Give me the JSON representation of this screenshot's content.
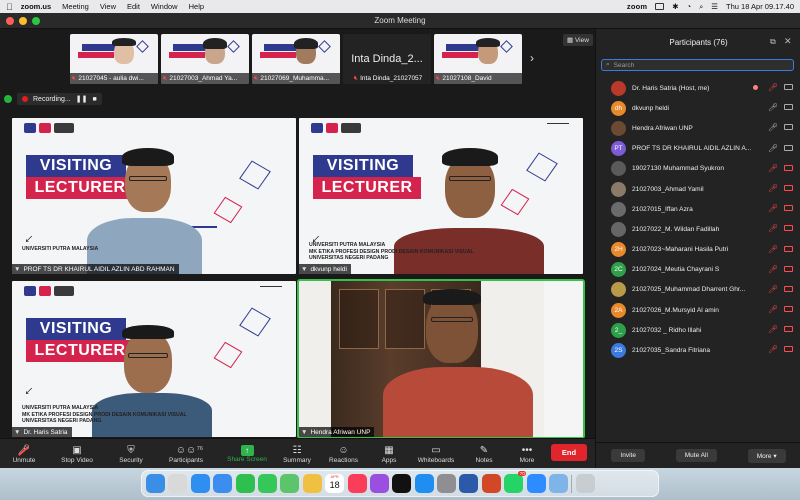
{
  "menubar": {
    "app_name": "zoom.us",
    "menus": [
      "Meeting",
      "View",
      "Edit",
      "Window",
      "Help"
    ],
    "brand": "zoom",
    "datetime": "Thu 18 Apr  09.17.40"
  },
  "window": {
    "title": "Zoom Meeting"
  },
  "strip": {
    "thumbs": [
      {
        "name": "21027045 - aulia dwi..."
      },
      {
        "name": "21027003_Ahmad Ya..."
      },
      {
        "name": "21027069_Muhamma..."
      },
      {
        "name": "Inta Dinda_21027057",
        "text": "Inta Dinda_2..."
      },
      {
        "name": "21027108_David"
      }
    ],
    "view_label": "View"
  },
  "recording": {
    "label": "Recording..."
  },
  "slides": {
    "visiting": "VISITING",
    "lecturer": "LECTURER",
    "caption1": "UNIVERSITI PUTRA MALAYSIA",
    "caption2": "MK ETIKA PROFESI DESIGN PRODI DESAIN KOMUNIKASI VISUAL",
    "caption3": "UNIVERSITAS NEGERI PADANG"
  },
  "tiles": [
    {
      "name": "PROF TS DR KHAIRUL AIDIL AZLIN ABD RAHMAN"
    },
    {
      "name": "dkvunp heldi"
    },
    {
      "name": "Dr. Haris Satria"
    },
    {
      "name": "Hendra Afriwan UNP"
    }
  ],
  "toolbar": {
    "unmute": "Unmute",
    "stop_video": "Stop Video",
    "security": "Security",
    "participants": "Participants",
    "participants_count": "76",
    "share_screen": "Share Screen",
    "summary": "Summary",
    "reactions": "Reactions",
    "apps": "Apps",
    "whiteboards": "Whiteboards",
    "notes": "Notes",
    "more": "More",
    "end": "End"
  },
  "participants": {
    "title": "Participants (76)",
    "search_placeholder": "Search",
    "list": [
      {
        "initials": "",
        "name": "Dr. Haris Satria (Host, me)",
        "color": "#b93a2a",
        "mic": "muted",
        "cam": "on",
        "rec": true
      },
      {
        "initials": "dh",
        "name": "dkvunp heldi",
        "color": "#e8892b",
        "mic": "on",
        "cam": "on"
      },
      {
        "initials": "",
        "name": "Hendra Afriwan UNP",
        "color": "#6a4a32",
        "mic": "on",
        "cam": "on"
      },
      {
        "initials": "PT",
        "name": "PROF TS DR KHAIRUL AIDIL AZLIN A...",
        "color": "#7d5bd6",
        "mic": "on",
        "cam": "on"
      },
      {
        "initials": "",
        "name": "19027130 Muhammad Syukron",
        "color": "#5a5a5a",
        "mic": "muted",
        "cam": "off"
      },
      {
        "initials": "",
        "name": "21027003_Ahmad Yamil",
        "color": "#8a7a6a",
        "mic": "muted",
        "cam": "off"
      },
      {
        "initials": "",
        "name": "21027015_Iffan Azra",
        "color": "#6b6b6b",
        "mic": "muted",
        "cam": "off"
      },
      {
        "initials": "",
        "name": "21027022_M. Wildan Fadillah",
        "color": "#666666",
        "mic": "muted",
        "cam": "off"
      },
      {
        "initials": "2H",
        "name": "21027023~Maharani Hasila Putri",
        "color": "#e8892b",
        "mic": "muted",
        "cam": "off"
      },
      {
        "initials": "2C",
        "name": "21027024_Meutia Chayrani S",
        "color": "#2fa04a",
        "mic": "muted",
        "cam": "off"
      },
      {
        "initials": "",
        "name": "21027025_Muhammad Dharrent Ghr...",
        "color": "#b89a4a",
        "mic": "muted",
        "cam": "off"
      },
      {
        "initials": "2A",
        "name": "21027026_M.Mursyid Al amin",
        "color": "#e8892b",
        "mic": "muted",
        "cam": "off"
      },
      {
        "initials": "2_",
        "name": "21027032 _ Ridho Illahi",
        "color": "#2fa04a",
        "mic": "muted",
        "cam": "off"
      },
      {
        "initials": "2S",
        "name": "21027035_Sandra Fitriana",
        "color": "#3b7be0",
        "mic": "muted",
        "cam": "off"
      }
    ],
    "invite": "Invite",
    "mute_all": "Mute All",
    "more": "More"
  },
  "dock": {
    "apps": [
      "finder",
      "launchpad",
      "safari",
      "mail",
      "facetime",
      "messages",
      "maps",
      "photos",
      "calendar",
      "music",
      "podcasts",
      "tv",
      "appstore",
      "settings",
      "word",
      "powerpoint",
      "whatsapp",
      "zoom",
      "preview",
      "trash"
    ],
    "calendar_day": "18",
    "calendar_month": "APR",
    "whatsapp_badge": "70"
  },
  "colors": {
    "accent_green": "#2fb34d",
    "end_red": "#e0262c",
    "mute_red": "#ff4b4b",
    "slide_blue": "#2f3a8f",
    "slide_red": "#d4234c"
  }
}
